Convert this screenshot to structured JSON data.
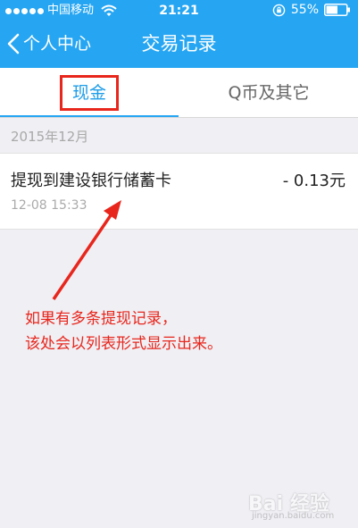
{
  "status_bar": {
    "carrier": "中国移动",
    "time": "21:21",
    "battery": "55%"
  },
  "nav": {
    "back_label": "个人中心",
    "title": "交易记录"
  },
  "tabs": [
    {
      "label": "现金",
      "selected": true
    },
    {
      "label": "Q币及其它",
      "selected": false
    }
  ],
  "section": {
    "month": "2015年12月"
  },
  "records": [
    {
      "title": "提现到建设银行储蓄卡",
      "amount": "- 0.13元",
      "time": "12-08 15:33"
    }
  ],
  "annotation": {
    "line1": "如果有多条提现记录，",
    "line2": "该处会以列表形式显示出来。"
  },
  "watermark": {
    "logo": "Bai 经验",
    "sub": "jingyan.baidu.com"
  },
  "colors": {
    "header": "#26a6f2",
    "accent": "#1e9de8",
    "annotation": "#e8261c",
    "background": "#efeff4"
  }
}
